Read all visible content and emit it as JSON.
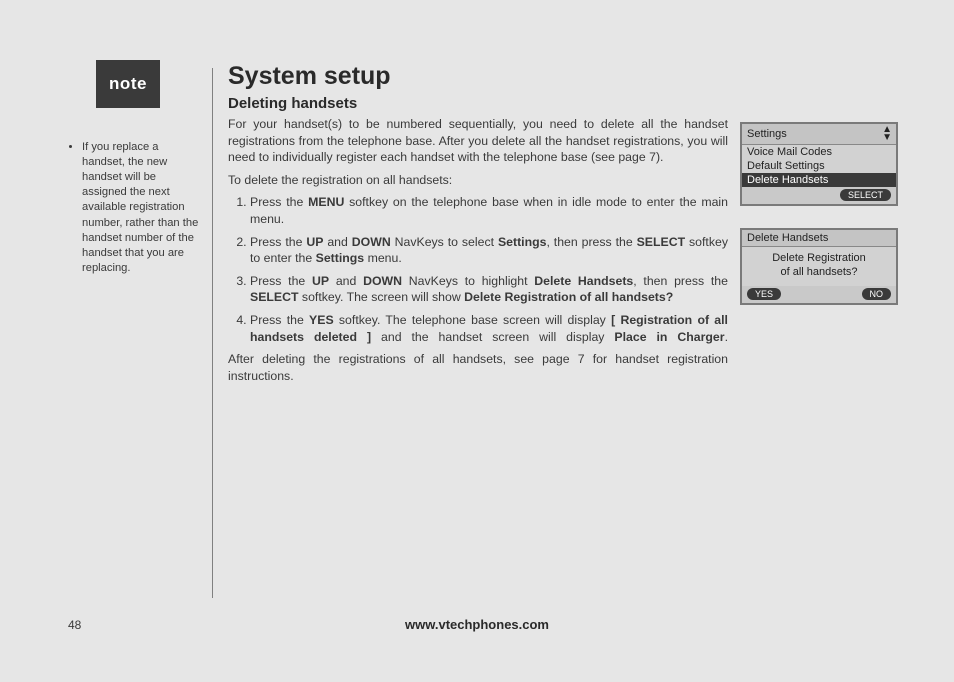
{
  "sidebar": {
    "note_badge": "note",
    "note_bullet": "If you replace a handset, the new handset will be assigned the next available registration number, rather than the handset number of the handset that you are replacing."
  },
  "main": {
    "h1": "System setup",
    "h2": "Deleting handsets",
    "intro": "For your handset(s) to be numbered sequentially, you need to delete all the handset registrations from the telephone base. After you delete all the handset registrations, you will need to individually register each handset with the telephone base (see page 7).",
    "lead": "To delete the registration on all handsets:",
    "steps": {
      "s1a": "Press the ",
      "s1b": "MENU",
      "s1c": " softkey on the telephone base when in idle mode to enter the main menu.",
      "s2a": "Press the ",
      "s2b": "UP",
      "s2c": " and ",
      "s2d": "DOWN",
      "s2e": " NavKeys to select ",
      "s2f": "Settings",
      "s2g": ", then press the ",
      "s2h": "SELECT",
      "s2i": " softkey to enter the ",
      "s2j": "Settings",
      "s2k": " menu.",
      "s3a": "Press the ",
      "s3b": "UP",
      "s3c": " and ",
      "s3d": "DOWN",
      "s3e": " NavKeys to highlight ",
      "s3f": "Delete Handsets",
      "s3g": ", then press the ",
      "s3h": "SELECT",
      "s3i": " softkey. The screen will show ",
      "s3j": "Delete Registration of all handsets?",
      "s4a": "Press the ",
      "s4b": "YES",
      "s4c": " softkey. The telephone base screen will display ",
      "s4d": "[ Registration of all handsets deleted ]",
      "s4e": " and the handset screen will display ",
      "s4f": "Place in Charger",
      "s4g": "."
    },
    "outro": "After deleting the registrations of all handsets, see page 7 for handset registration instructions."
  },
  "screen1": {
    "title": "Settings",
    "items": [
      "Voice Mail Codes",
      "Default Settings",
      "Delete Handsets"
    ],
    "softkey": "SELECT"
  },
  "screen2": {
    "title": "Delete Handsets",
    "line1": "Delete Registration",
    "line2": "of all handsets?",
    "soft_left": "YES",
    "soft_right": "NO"
  },
  "footer": {
    "page": "48",
    "url": "www.vtechphones.com"
  }
}
